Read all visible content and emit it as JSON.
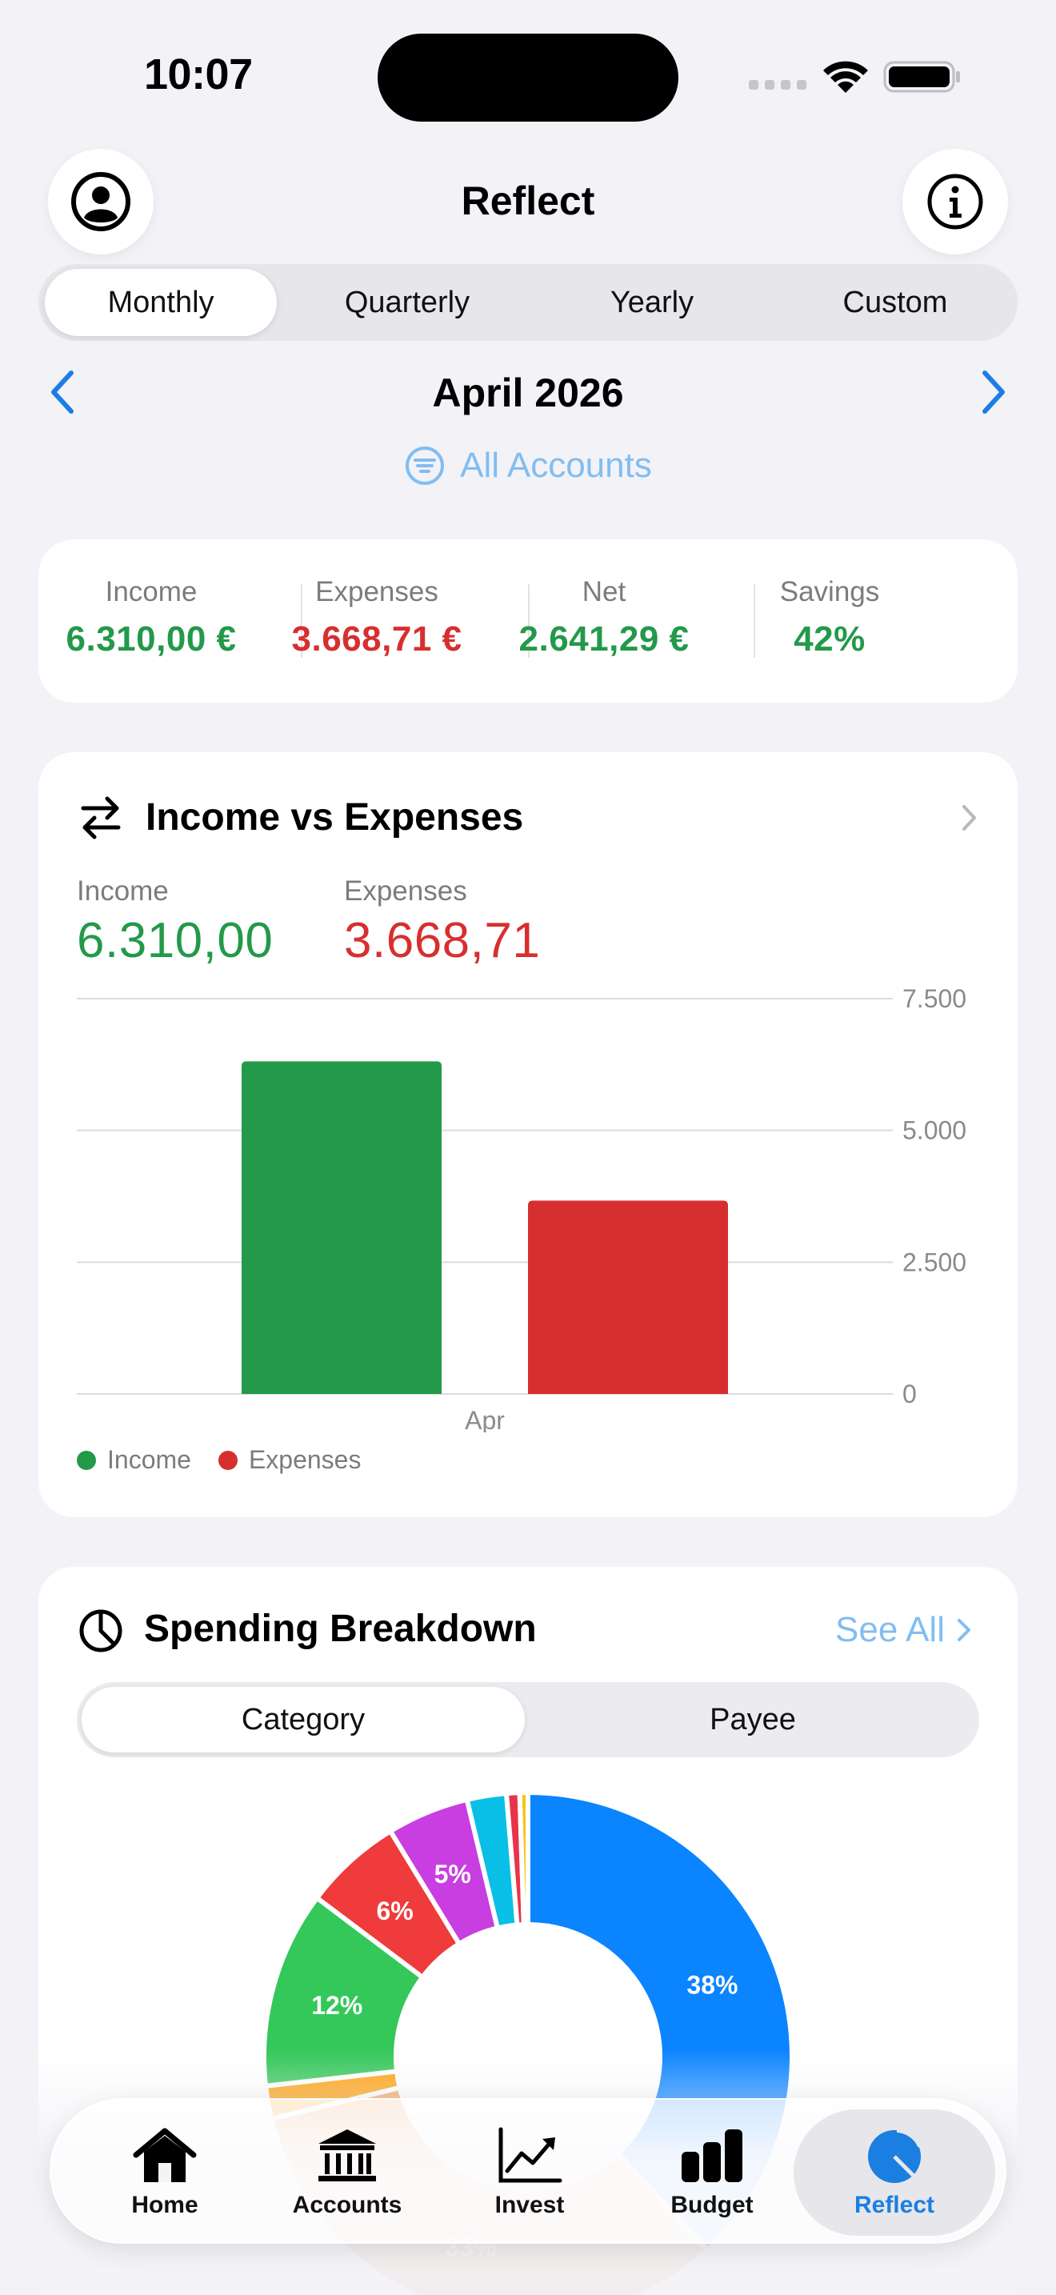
{
  "status": {
    "time": "10:07"
  },
  "header": {
    "title": "Reflect"
  },
  "periods": [
    {
      "label": "Monthly",
      "active": true
    },
    {
      "label": "Quarterly",
      "active": false
    },
    {
      "label": "Yearly",
      "active": false
    },
    {
      "label": "Custom",
      "active": false
    }
  ],
  "month": {
    "title": "April 2026"
  },
  "filter": {
    "label": "All Accounts"
  },
  "summary": {
    "income": {
      "label": "Income",
      "value": "6.310,00 €"
    },
    "expenses": {
      "label": "Expenses",
      "value": "3.668,71 €"
    },
    "net": {
      "label": "Net",
      "value": "2.641,29 €"
    },
    "savings": {
      "label": "Savings",
      "value": "42%"
    }
  },
  "income_vs_expenses": {
    "title": "Income vs Expenses",
    "income_label": "Income",
    "income_value": "6.310,00",
    "expenses_label": "Expenses",
    "expenses_value": "3.668,71"
  },
  "colors": {
    "income": "#23994a",
    "expenses": "#d72f2f",
    "accent": "#1a7fe0",
    "accent_light": "#82bdf0"
  },
  "chart_data": [
    {
      "type": "bar",
      "categories": [
        "Apr"
      ],
      "series": [
        {
          "name": "Income",
          "values": [
            6310.0
          ],
          "color": "#23994a"
        },
        {
          "name": "Expenses",
          "values": [
            3668.71
          ],
          "color": "#d72f2f"
        }
      ],
      "yticks": [
        "0",
        "2.500",
        "5.000",
        "7.500"
      ],
      "ytick_values": [
        0,
        2500,
        5000,
        7500
      ],
      "ylim": [
        0,
        7500
      ],
      "grid": true,
      "legend": "bottom-left"
    },
    {
      "type": "pie",
      "donut": true,
      "slices": [
        {
          "value": 38,
          "label": "38%",
          "color": "#0a84ff"
        },
        {
          "value": 33,
          "label": "33%",
          "color": "#f2a96b"
        },
        {
          "value": 2,
          "label": "",
          "color": "#ff9f0a"
        },
        {
          "value": 12,
          "label": "12%",
          "color": "#34c759"
        },
        {
          "value": 6,
          "label": "6%",
          "color": "#ef3b3b"
        },
        {
          "value": 5,
          "label": "5%",
          "color": "#c83ee0"
        },
        {
          "value": 2.4,
          "label": "",
          "color": "#0abfe6"
        },
        {
          "value": 0.8,
          "label": "",
          "color": "#e8344a"
        },
        {
          "value": 0.5,
          "label": "",
          "color": "#f5c518"
        }
      ]
    }
  ],
  "spending": {
    "title": "Spending Breakdown",
    "see_all": "See All",
    "tabs": [
      {
        "label": "Category",
        "active": true
      },
      {
        "label": "Payee",
        "active": false
      }
    ]
  },
  "tabbar": {
    "items": [
      {
        "label": "Home",
        "icon": "house-icon",
        "active": false
      },
      {
        "label": "Accounts",
        "icon": "bank-icon",
        "active": false
      },
      {
        "label": "Invest",
        "icon": "chart-line-icon",
        "active": false
      },
      {
        "label": "Budget",
        "icon": "bars-icon",
        "active": false
      },
      {
        "label": "Reflect",
        "icon": "pie-icon",
        "active": true
      }
    ]
  }
}
